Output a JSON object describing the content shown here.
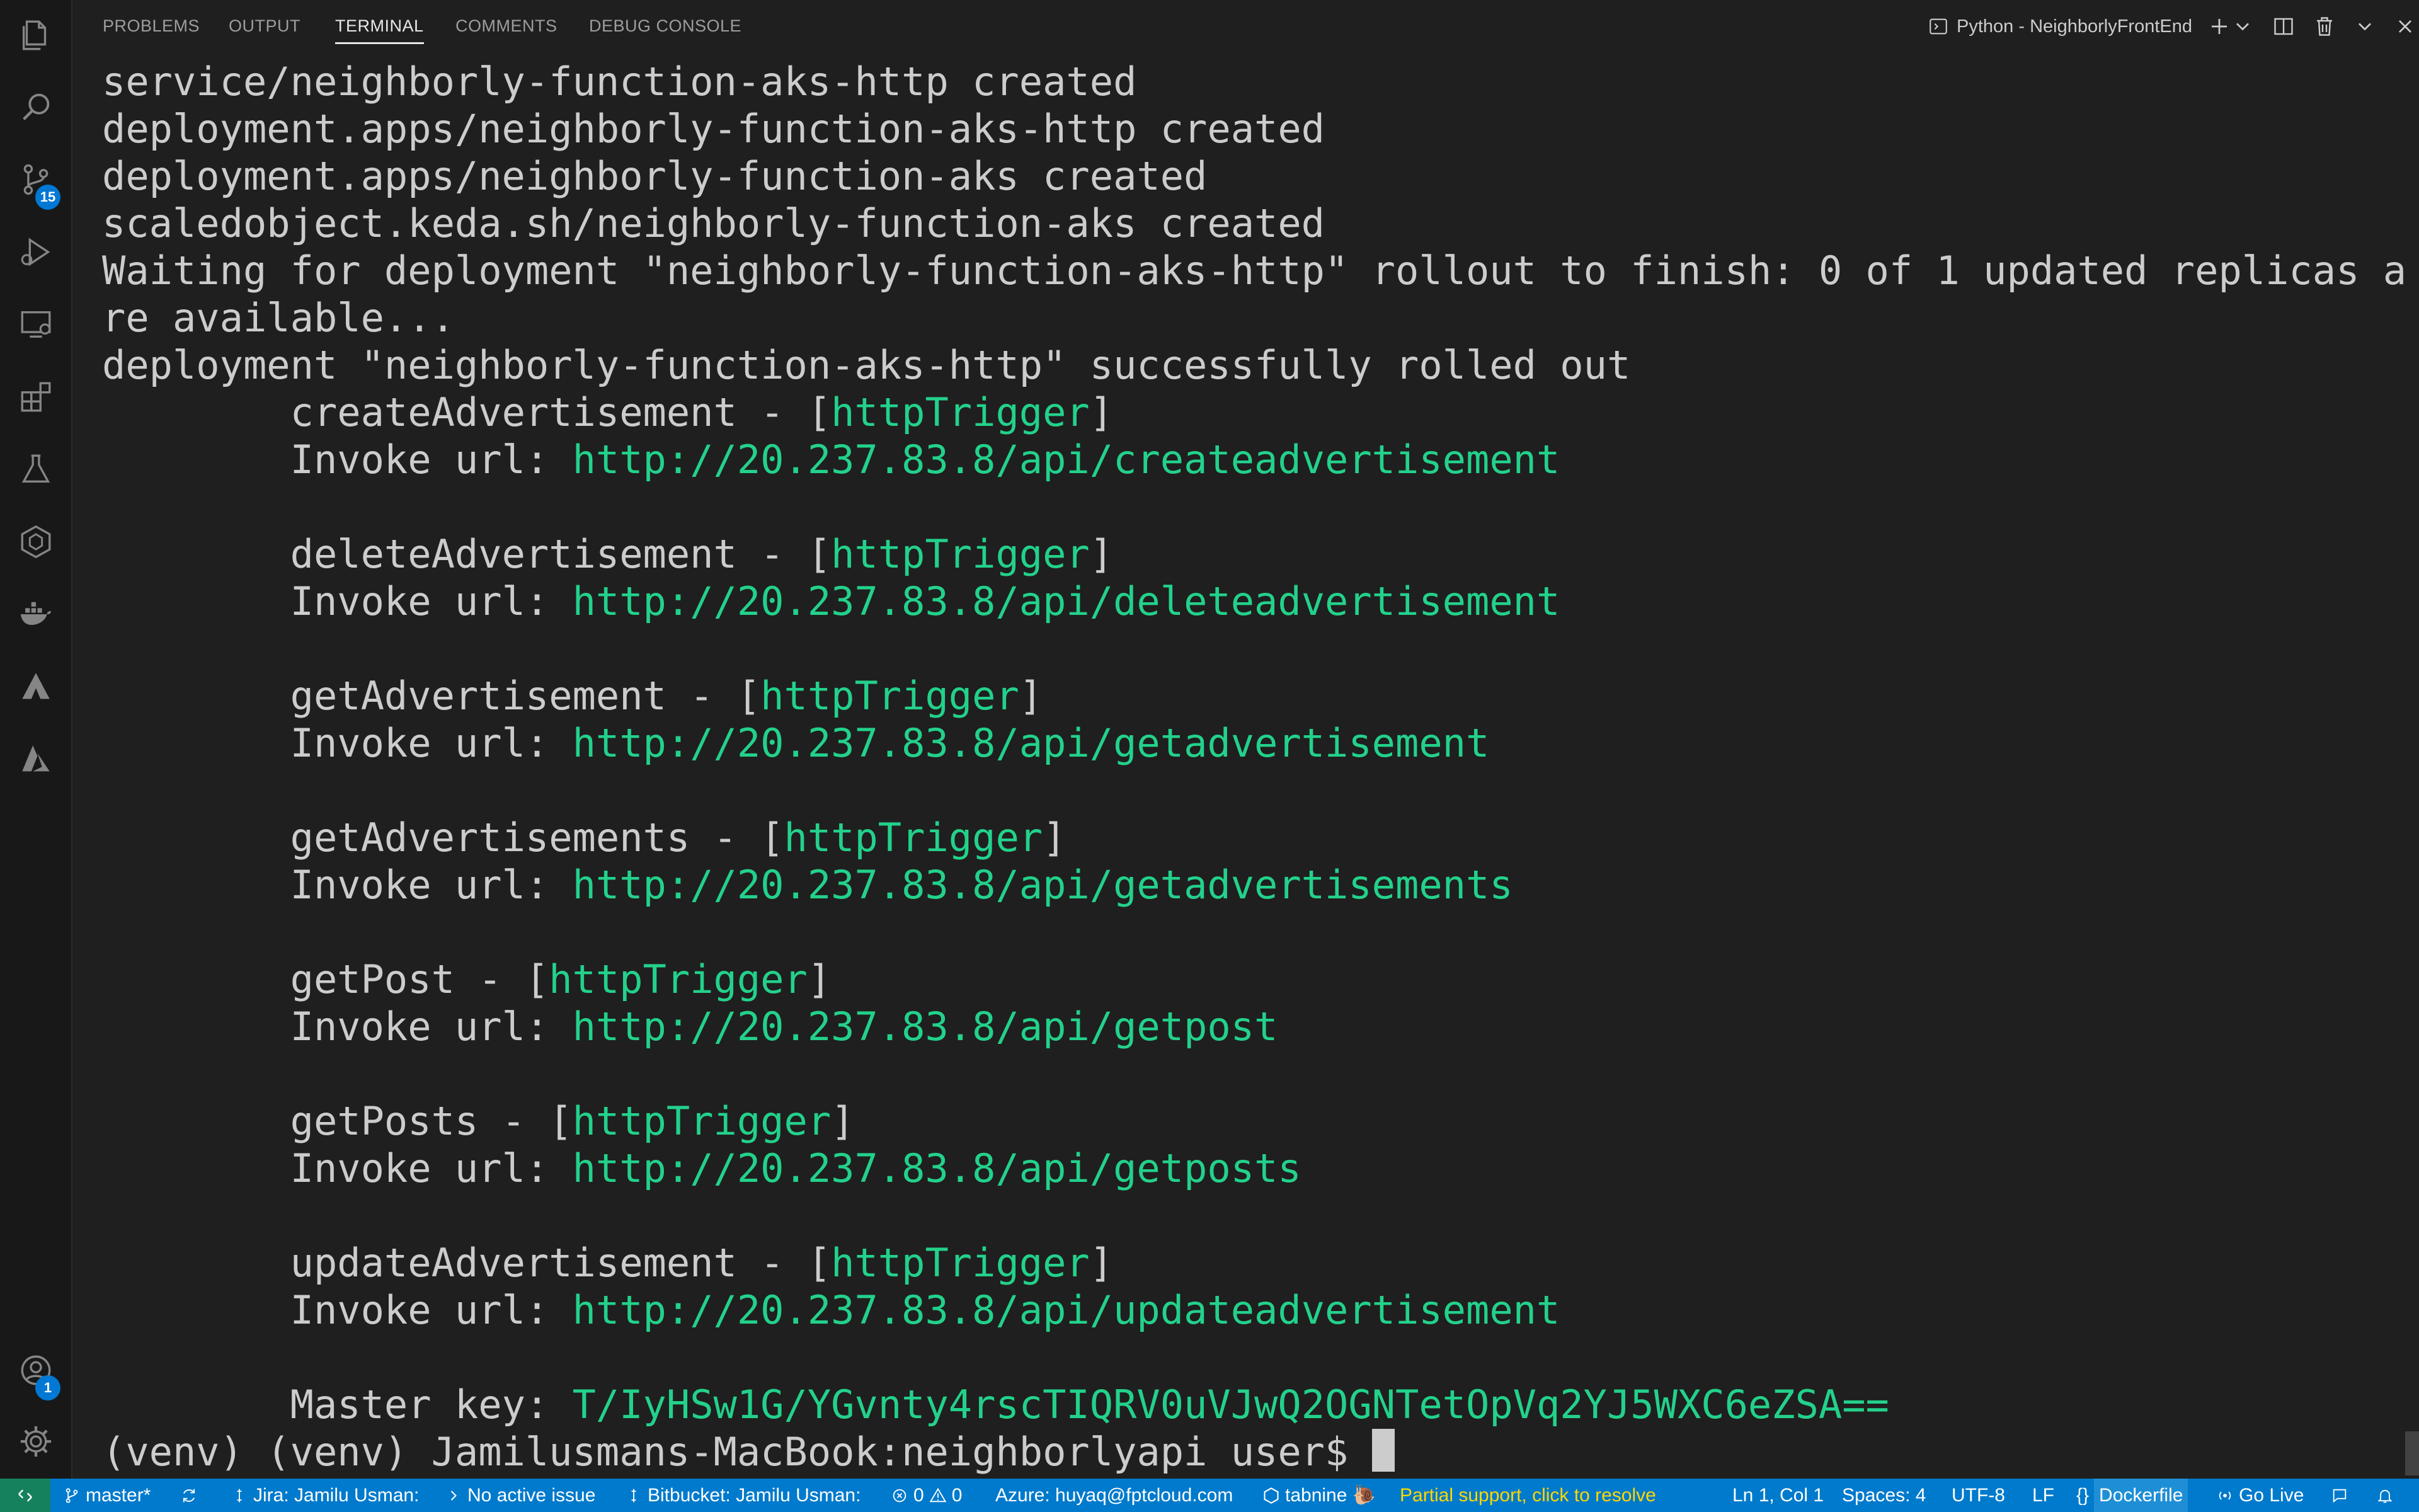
{
  "activity_bar": {
    "items": [
      {
        "name": "explorer"
      },
      {
        "name": "search"
      },
      {
        "name": "source-control",
        "badge": "15"
      },
      {
        "name": "run-and-debug"
      },
      {
        "name": "remote-explorer"
      },
      {
        "name": "extensions"
      },
      {
        "name": "testing"
      },
      {
        "name": "kubernetes"
      },
      {
        "name": "docker"
      },
      {
        "name": "atlassian"
      },
      {
        "name": "azure"
      }
    ],
    "accounts_badge": "1"
  },
  "panel": {
    "tabs": [
      {
        "label": "PROBLEMS"
      },
      {
        "label": "OUTPUT"
      },
      {
        "label": "TERMINAL",
        "active": true
      },
      {
        "label": "COMMENTS"
      },
      {
        "label": "DEBUG CONSOLE"
      }
    ],
    "terminal_name": "Python - NeighborlyFrontEnd"
  },
  "terminal": {
    "lines": [
      {
        "text": "service/neighborly-function-aks-http created"
      },
      {
        "text": "deployment.apps/neighborly-function-aks-http created"
      },
      {
        "text": "deployment.apps/neighborly-function-aks created"
      },
      {
        "text": "scaledobject.keda.sh/neighborly-function-aks created"
      },
      {
        "text": "Waiting for deployment \"neighborly-function-aks-http\" rollout to finish: 0 of 1 updated replicas a"
      },
      {
        "text": "re available..."
      },
      {
        "text": "deployment \"neighborly-function-aks-http\" successfully rolled out"
      }
    ],
    "functions": [
      {
        "name": "createAdvertisement",
        "trigger": "httpTrigger",
        "url_label": "Invoke url:",
        "url": "http://20.237.83.8/api/createadvertisement"
      },
      {
        "name": "deleteAdvertisement",
        "trigger": "httpTrigger",
        "url_label": "Invoke url:",
        "url": "http://20.237.83.8/api/deleteadvertisement"
      },
      {
        "name": "getAdvertisement",
        "trigger": "httpTrigger",
        "url_label": "Invoke url:",
        "url": "http://20.237.83.8/api/getadvertisement"
      },
      {
        "name": "getAdvertisements",
        "trigger": "httpTrigger",
        "url_label": "Invoke url:",
        "url": "http://20.237.83.8/api/getadvertisements"
      },
      {
        "name": "getPost",
        "trigger": "httpTrigger",
        "url_label": "Invoke url:",
        "url": "http://20.237.83.8/api/getpost"
      },
      {
        "name": "getPosts",
        "trigger": "httpTrigger",
        "url_label": "Invoke url:",
        "url": "http://20.237.83.8/api/getposts"
      },
      {
        "name": "updateAdvertisement",
        "trigger": "httpTrigger",
        "url_label": "Invoke url:",
        "url": "http://20.237.83.8/api/updateadvertisement"
      }
    ],
    "master_key_label": "Master key:",
    "master_key": "T/IyHSw1G/YGvnty4rscTIQRV0uVJwQ2OGNTetOpVq2YJ5WXC6eZSA==",
    "prompt": "(venv) (venv) Jamilusmans-MacBook:neighborlyapi user$ "
  },
  "status_bar": {
    "branch": "master*",
    "jira": "Jira: Jamilu Usman:",
    "issue": "No active issue",
    "bitbucket": "Bitbucket: Jamilu Usman:",
    "errors": "0",
    "warnings": "0",
    "azure": "Azure: huyaq@fptcloud.com",
    "tabnine": "tabnine",
    "partial_support": "Partial support, click to resolve",
    "cursor_pos": "Ln 1, Col 1",
    "spaces": "Spaces: 4",
    "encoding": "UTF-8",
    "eol": "LF",
    "language": "Dockerfile",
    "go_live": "Go Live",
    "colors": {
      "background": "#007acc",
      "remote": "#16825d",
      "partial_support": "#ffd700"
    }
  }
}
